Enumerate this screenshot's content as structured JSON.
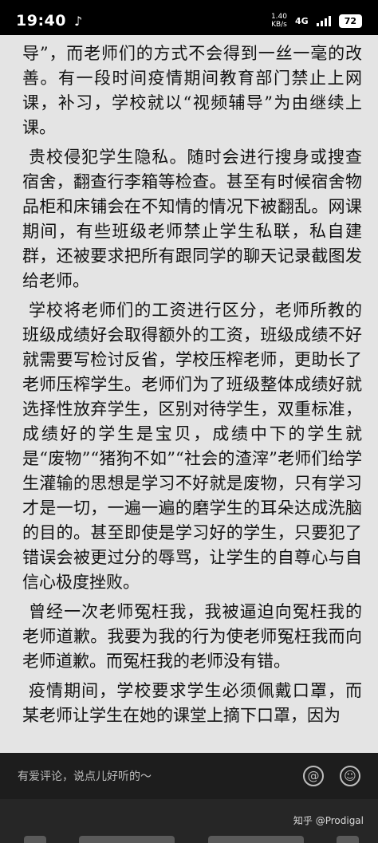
{
  "status_bar": {
    "time": "19:40",
    "app_icon": "tiktok-icon",
    "speed_value": "1.40",
    "speed_unit": "KB/s",
    "network": "4G",
    "battery": "72"
  },
  "article": {
    "paragraphs": [
      "导”，而老师们的方式不会得到一丝一毫的改善。有一段时间疫情期间教育部门禁止上网课，补习，学校就以“视频辅导”为由继续上课。",
      "贵校侵犯学生隐私。随时会进行搜身或搜查宿舍，翻查行李箱等检查。甚至有时候宿舍物品柜和床铺会在不知情的情况下被翻乱。网课期间，有些班级老师禁止学生私联，私自建群，还被要求把所有跟同学的聊天记录截图发给老师。",
      "学校将老师们的工资进行区分，老师所教的班级成绩好会取得额外的工资，班级成绩不好就需要写检讨反省，学校压榨老师，更助长了老师压榨学生。老师们为了班级整体成绩好就选择性放弃学生，区别对待学生，双重标准，成绩好的学生是宝贝，成绩中下的学生就是“废物”“猪狗不如”“社会的渣滓”老师们给学生灌输的思想是学习不好就是废物，只有学习才是一切，一遍一遍的磨学生的耳朵达成洗脑的目的。甚至即使是学习好的学生，只要犯了错误会被更过分的辱骂，让学生的自尊心与自信心极度挫败。",
      "曾经一次老师冤枉我，我被逼迫向冤枉我的老师道歉。我要为我的行为使老师冤枉我而向老师道歉。而冤枉我的老师没有错。",
      "疫情期间，学校要求学生必须佩戴口罩，而某老师让学生在她的课堂上摘下口罩，因为"
    ]
  },
  "comment_bar": {
    "placeholder": "有爱评论，说点儿好听的～",
    "mention_icon": "at-icon",
    "emoji_icon": "emoji-icon"
  },
  "watermark": "知乎 @Prodigal"
}
